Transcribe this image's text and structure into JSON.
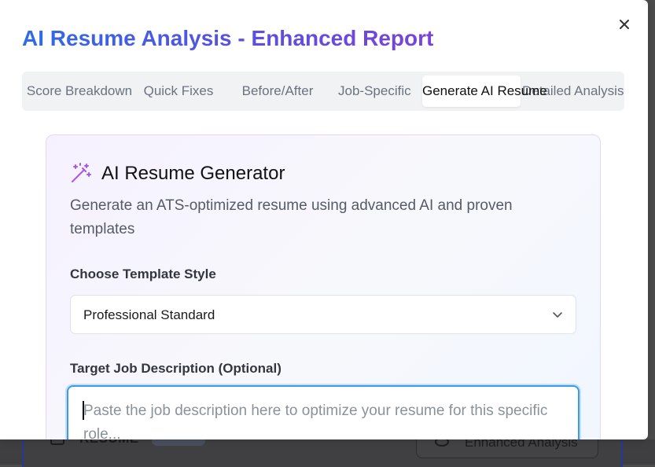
{
  "modal": {
    "title": "AI Resume Analysis - Enhanced Report",
    "close_icon": "close-icon"
  },
  "tabs": [
    {
      "label": "Score Breakdown",
      "active": false
    },
    {
      "label": "Quick Fixes",
      "active": false
    },
    {
      "label": "Before/After",
      "active": false
    },
    {
      "label": "Job-Specific",
      "active": false
    },
    {
      "label": "Generate AI Resume",
      "active": true
    },
    {
      "label": "Detailed Analysis",
      "active": false
    }
  ],
  "generator": {
    "icon": "magic-wand-icon",
    "title": "AI Resume Generator",
    "subtitle": "Generate an ATS-optimized resume using advanced AI and proven templates",
    "template_label": "Choose Template Style",
    "template_value": "Professional Standard",
    "job_label": "Target Job Description (Optional)",
    "job_placeholder": "Paste the job description here to optimize your resume for this specific role..."
  },
  "background": {
    "card_label": "RESUME",
    "button_label": "Enhanced Analysis",
    "button_icon": "eye-icon"
  },
  "colors": {
    "title_gradient_start": "#2f6be6",
    "title_gradient_end": "#7a43d8",
    "focus_ring": "#3b9be8",
    "wand": "#a855f7"
  }
}
